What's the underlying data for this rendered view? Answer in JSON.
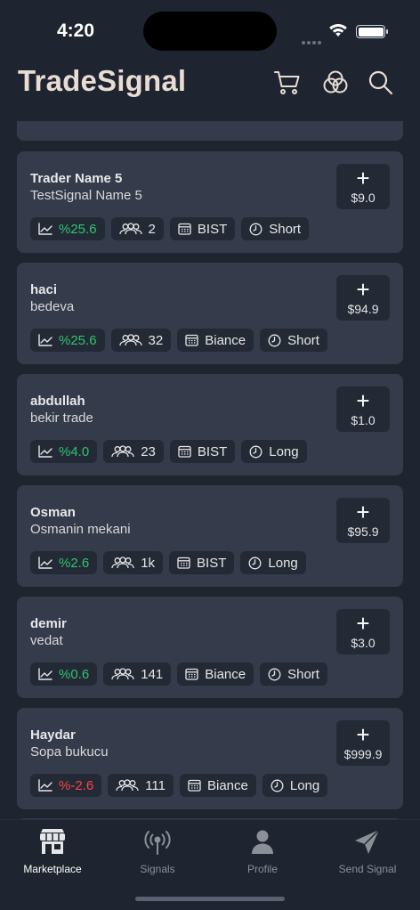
{
  "status_bar": {
    "time": "4:20"
  },
  "header": {
    "title": "TradeSignal",
    "icons": [
      "cart-icon",
      "overlapping-circles-icon",
      "search-icon"
    ]
  },
  "colors": {
    "positive": "#2fc46e",
    "negative": "#ff4343",
    "card_bg": "#343b4a",
    "chip_bg": "#232a36",
    "title": "#e9dcd2"
  },
  "signals": [
    {
      "trader": "Trader Name 5",
      "signal": "TestSignal Name 5",
      "price": "$9.0",
      "performance": "%25.6",
      "trend": "positive",
      "subscribers": "2",
      "market": "BIST",
      "term": "Short"
    },
    {
      "trader": "haci",
      "signal": "bedeva",
      "price": "$94.9",
      "performance": "%25.6",
      "trend": "positive",
      "subscribers": "32",
      "market": "Biance",
      "term": "Short"
    },
    {
      "trader": "abdullah",
      "signal": "bekir trade",
      "price": "$1.0",
      "performance": "%4.0",
      "trend": "positive",
      "subscribers": "23",
      "market": "BIST",
      "term": "Long"
    },
    {
      "trader": "Osman",
      "signal": "Osmanin mekani",
      "price": "$95.9",
      "performance": "%2.6",
      "trend": "positive",
      "subscribers": "1k",
      "market": "BIST",
      "term": "Long"
    },
    {
      "trader": "demir",
      "signal": "vedat",
      "price": "$3.0",
      "performance": "%0.6",
      "trend": "positive",
      "subscribers": "141",
      "market": "Biance",
      "term": "Short"
    },
    {
      "trader": "Haydar",
      "signal": "Sopa bukucu",
      "price": "$999.9",
      "performance": "%-2.6",
      "trend": "negative",
      "subscribers": "111",
      "market": "Biance",
      "term": "Long"
    }
  ],
  "card_buy_symbol": "+",
  "tabs": [
    {
      "label": "Marketplace",
      "icon": "store-icon",
      "active": true
    },
    {
      "label": "Signals",
      "icon": "antenna-icon",
      "active": false
    },
    {
      "label": "Profile",
      "icon": "person-icon",
      "active": false
    },
    {
      "label": "Send Signal",
      "icon": "paper-plane-icon",
      "active": false
    }
  ]
}
